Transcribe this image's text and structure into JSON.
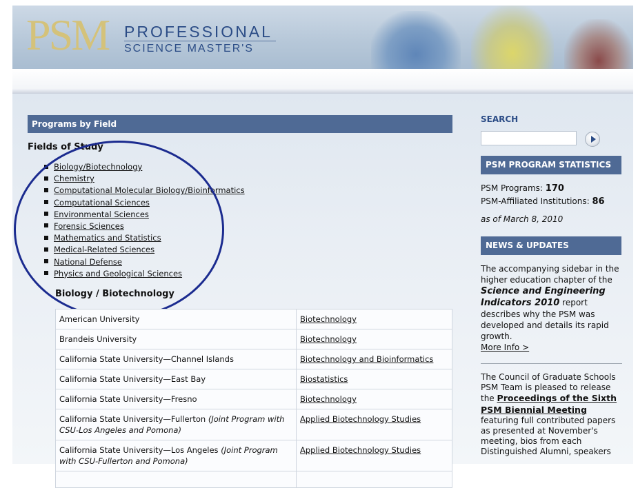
{
  "header": {
    "logo_mark": "PSM",
    "logo_line1": "PROFESSIONAL",
    "logo_line2": "SCIENCE MASTER'S"
  },
  "main": {
    "section_title": "Programs by Field",
    "fields_heading": "Fields of Study",
    "fields": [
      "Biology/Biotechnology",
      "Chemistry",
      "Computational Molecular Biology/Bioinformatics",
      "Computational Sciences",
      "Environmental Sciences",
      "Forensic Sciences",
      "Mathematics and Statistics",
      "Medical-Related Sciences",
      "National Defense",
      "Physics and Geological Sciences"
    ],
    "bio_heading": "Biology / Biotechnology",
    "programs": [
      {
        "institution": "American University",
        "note": "",
        "program": "Biotechnology"
      },
      {
        "institution": "Brandeis University",
        "note": "",
        "program": "Biotechnology"
      },
      {
        "institution": "California State University—Channel Islands",
        "note": "",
        "program": "Biotechnology and Bioinformatics"
      },
      {
        "institution": "California State University—East Bay",
        "note": "",
        "program": "Biostatistics"
      },
      {
        "institution": "California State University—Fresno",
        "note": "",
        "program": "Biotechnology"
      },
      {
        "institution": "California State University—Fullerton",
        "note": "(Joint Program with CSU-Los Angeles and Pomona)",
        "program": "Applied Biotechnology Studies"
      },
      {
        "institution": "California State University—Los Angeles",
        "note": "(Joint Program with CSU-Fullerton and Pomona)",
        "program": "Applied Biotechnology Studies"
      }
    ]
  },
  "sidebar": {
    "search_label": "SEARCH",
    "search_value": "",
    "stats_title": "PSM PROGRAM STATISTICS",
    "stat1_label": "PSM Programs:",
    "stat1_value": "170",
    "stat2_label": "PSM-Affiliated Institutions:",
    "stat2_value": "86",
    "stats_date": "as of March 8, 2010",
    "news_title": "NEWS & UPDATES",
    "news1_text1": "The accompanying sidebar in the higher education chapter of the",
    "news1_em": "Science and Engineering Indicators 2010",
    "news1_text2": "report describes why the PSM was developed and details its rapid growth.",
    "news1_more": "More Info >",
    "news2_text1": "The Council of Graduate Schools PSM Team is pleased to release the",
    "news2_link": "Proceedings of the Sixth PSM Biennial Meeting",
    "news2_text2": "featuring full contributed papers as presented at November's meeting, bios from each Distinguished Alumni, speakers"
  },
  "colors": {
    "nav_bar": "#4f6a95",
    "logo_gold": "#d4c27a",
    "logo_blue": "#2b4c86",
    "annotation_circle": "#1b2b8f"
  }
}
